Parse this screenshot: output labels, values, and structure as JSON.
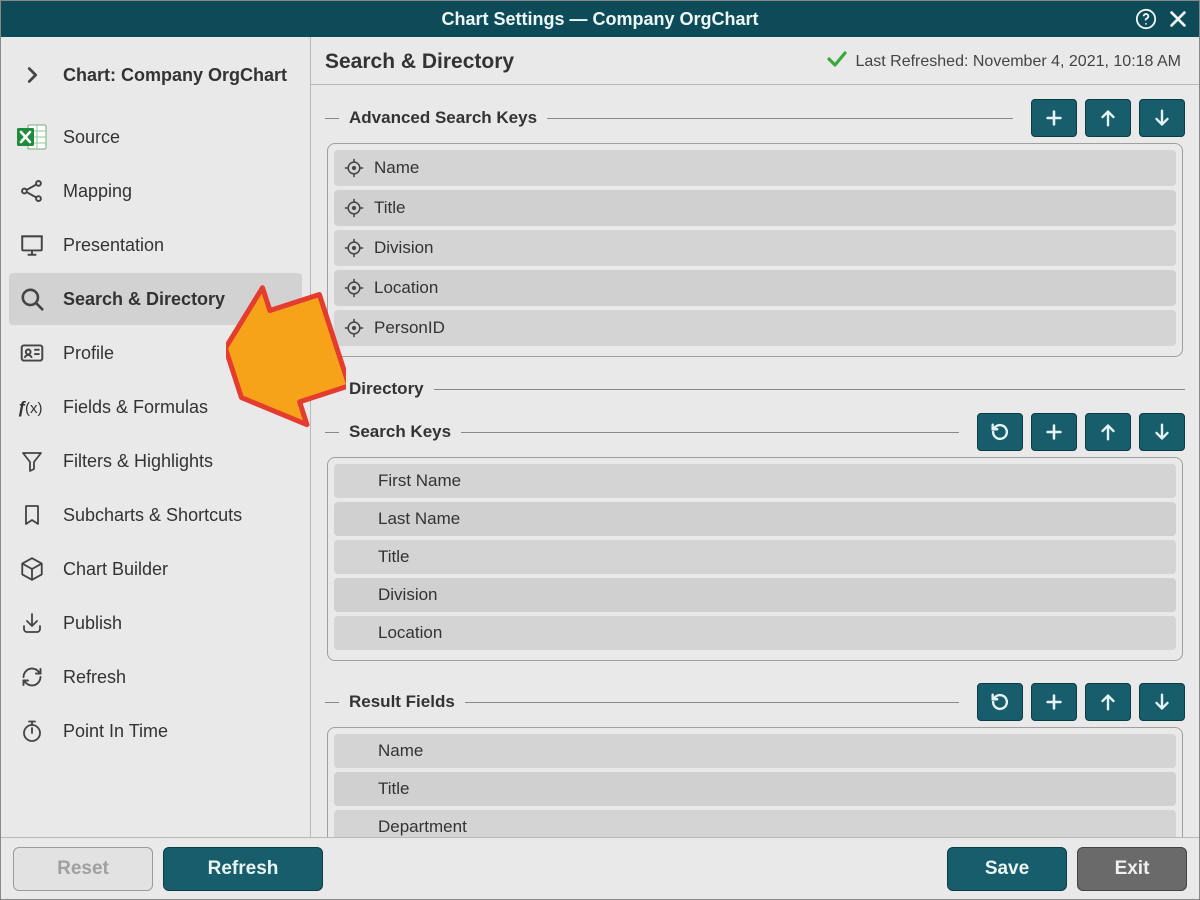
{
  "titlebar": {
    "title": "Chart Settings — Company OrgChart"
  },
  "sidebar": {
    "items": [
      {
        "label": "Chart: Company OrgChart",
        "icon": "chevron-right",
        "kind": "head"
      },
      {
        "label": "Source",
        "icon": "excel"
      },
      {
        "label": "Mapping",
        "icon": "nodes"
      },
      {
        "label": "Presentation",
        "icon": "presentation"
      },
      {
        "label": "Search & Directory",
        "icon": "search",
        "active": true
      },
      {
        "label": "Profile",
        "icon": "idcard"
      },
      {
        "label": "Fields & Formulas",
        "icon": "fx"
      },
      {
        "label": "Filters & Highlights",
        "icon": "funnel"
      },
      {
        "label": "Subcharts & Shortcuts",
        "icon": "bookmark"
      },
      {
        "label": "Chart Builder",
        "icon": "cube"
      },
      {
        "label": "Publish",
        "icon": "download"
      },
      {
        "label": "Refresh",
        "icon": "refresh"
      },
      {
        "label": "Point In Time",
        "icon": "stopwatch"
      }
    ]
  },
  "header": {
    "title": "Search & Directory",
    "status_label": "Last Refreshed: November 4, 2021, 10:18 AM"
  },
  "sections": {
    "advanced_search_keys": {
      "label": "Advanced Search Keys",
      "buttons": [
        "add",
        "up",
        "down"
      ],
      "items": [
        "Name",
        "Title",
        "Division",
        "Location",
        "PersonID"
      ],
      "targeted": true
    },
    "directory": {
      "label": "Directory"
    },
    "search_keys": {
      "label": "Search Keys",
      "buttons": [
        "reset",
        "add",
        "up",
        "down"
      ],
      "items": [
        "First Name",
        "Last Name",
        "Title",
        "Division",
        "Location"
      ],
      "targeted": false
    },
    "result_fields": {
      "label": "Result Fields",
      "buttons": [
        "reset",
        "add",
        "up",
        "down"
      ],
      "items": [
        "Name",
        "Title",
        "Department"
      ],
      "targeted": false
    }
  },
  "footer": {
    "reset": "Reset",
    "refresh": "Refresh",
    "save": "Save",
    "exit": "Exit"
  }
}
